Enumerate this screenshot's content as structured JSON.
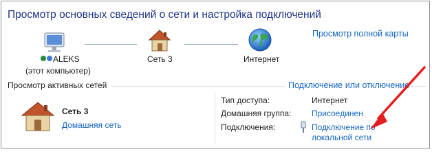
{
  "header": {
    "title": "Просмотр основных сведений о сети и настройка подключений",
    "full_map_link": "Просмотр полной карты"
  },
  "network_map": {
    "nodes": [
      {
        "name": "ALEKS",
        "sublabel": "(этот компьютер)",
        "icon": "computer-network-icon"
      },
      {
        "name": "Сеть 3",
        "icon": "house-icon"
      },
      {
        "name": "Интернет",
        "icon": "globe-icon"
      }
    ]
  },
  "active_networks": {
    "section_label": "Просмотр активных сетей",
    "connect_disconnect_link": "Подключение или отключение",
    "network": {
      "name": "Сеть  3",
      "type_link": "Домашняя сеть",
      "icon": "house-icon"
    },
    "properties": {
      "access_type_label": "Тип доступа:",
      "access_type_value": "Интернет",
      "homegroup_label": "Домашняя группа:",
      "homegroup_value": "Присоединен",
      "connections_label": "Подключения:",
      "connection_value_line1": "Подключение по",
      "connection_value_line2": "локальной сети",
      "connection_icon": "ethernet-plug-icon"
    }
  },
  "colors": {
    "title": "#1e3287",
    "link": "#1565c0",
    "annotation_arrow": "#e31e1e"
  }
}
